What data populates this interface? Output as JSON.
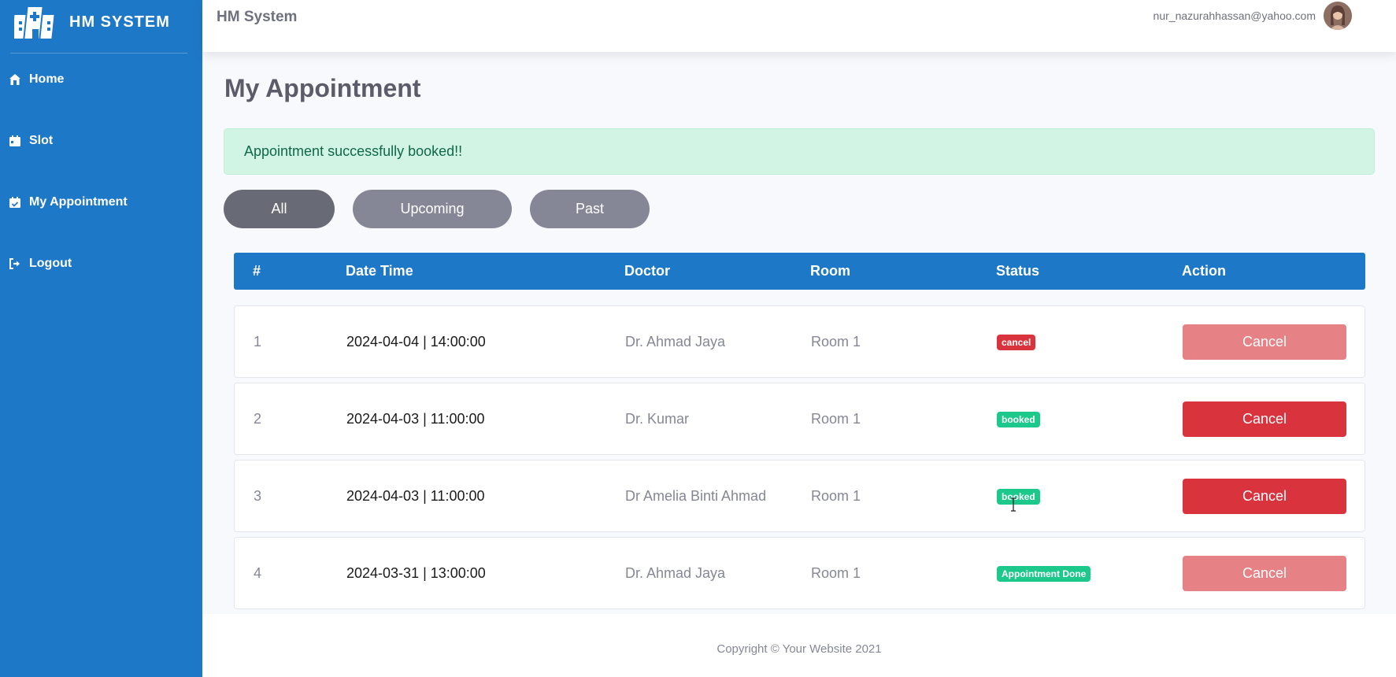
{
  "sidebar": {
    "brand": "HM SYSTEM",
    "items": [
      {
        "label": "Home",
        "icon": "home-icon"
      },
      {
        "label": "Slot",
        "icon": "calendar-icon"
      },
      {
        "label": "My Appointment",
        "icon": "calendar-check-icon"
      },
      {
        "label": "Logout",
        "icon": "logout-icon"
      }
    ]
  },
  "topbar": {
    "title": "HM System",
    "user_email": "nur_nazurahhassan@yahoo.com"
  },
  "page": {
    "title": "My Appointment",
    "alert": "Appointment successfully booked!!"
  },
  "filters": {
    "all": "All",
    "upcoming": "Upcoming",
    "past": "Past",
    "active": "All"
  },
  "table": {
    "headers": [
      "#",
      "Date Time",
      "Doctor",
      "Room",
      "Status",
      "Action"
    ],
    "rows": [
      {
        "num": "1",
        "datetime": "2024-04-04 | 14:00:00",
        "doctor": "Dr. Ahmad Jaya",
        "room": "Room 1",
        "status": "cancel",
        "status_color": "#d9343d",
        "action": "Cancel",
        "action_enabled": false
      },
      {
        "num": "2",
        "datetime": "2024-04-03 | 11:00:00",
        "doctor": "Dr. Kumar",
        "room": "Room 1",
        "status": "booked",
        "status_color": "#1cc88a",
        "action": "Cancel",
        "action_enabled": true
      },
      {
        "num": "3",
        "datetime": "2024-04-03 | 11:00:00",
        "doctor": "Dr Amelia Binti Ahmad",
        "room": "Room 1",
        "status": "booked",
        "status_color": "#1cc88a",
        "action": "Cancel",
        "action_enabled": true
      },
      {
        "num": "4",
        "datetime": "2024-03-31 | 13:00:00",
        "doctor": "Dr. Ahmad Jaya",
        "room": "Room 1",
        "status": "Appointment Done",
        "status_color": "#1cc88a",
        "action": "Cancel",
        "action_enabled": false
      }
    ]
  },
  "footer": {
    "text": "Copyright © Your Website 2021"
  },
  "colors": {
    "primary": "#1e78c8",
    "danger": "#d9343d",
    "success": "#1cc88a",
    "alert_bg": "#d2f4e4"
  }
}
